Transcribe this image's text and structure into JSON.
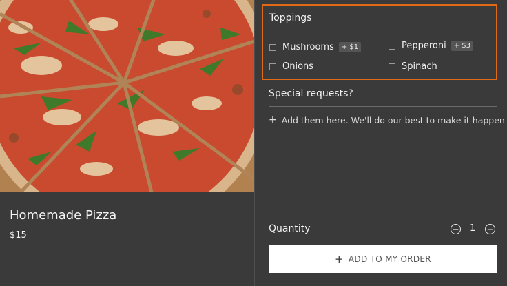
{
  "product": {
    "name": "Homemade Pizza",
    "price": "$15",
    "image": "pizza-photo"
  },
  "toppings": {
    "title": "Toppings",
    "options": [
      {
        "label": "Mushrooms",
        "price": "+ $1",
        "checked": false
      },
      {
        "label": "Pepperoni",
        "price": "+ $3",
        "checked": false
      },
      {
        "label": "Onions",
        "price": "",
        "checked": false
      },
      {
        "label": "Spinach",
        "price": "",
        "checked": false
      }
    ]
  },
  "special_requests": {
    "title": "Special requests?",
    "add_prompt": "Add them here. We'll do our best to make it happen"
  },
  "quantity": {
    "label": "Quantity",
    "value": "1",
    "decrement_icon": "minus-circle-icon",
    "increment_icon": "plus-circle-icon"
  },
  "add_button": {
    "label": "ADD TO MY ORDER",
    "icon": "plus-icon"
  },
  "colors": {
    "background": "#3a3a3a",
    "highlight_border": "#e26a17",
    "button_bg": "#ffffff"
  }
}
